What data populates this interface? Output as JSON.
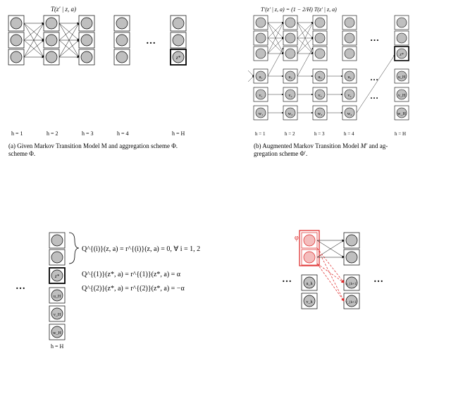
{
  "titles": {
    "a_top": "T(z′ | z, a)",
    "b_top": "T′(z′ | z, a) = (1 − 2/H) T(z′ | z, a)"
  },
  "captions": {
    "a": "(a) Given Markov Transition Model M and aggregation scheme Φ.",
    "b": "(b) Augmented Markov Transition Model M′ and aggregation scheme Φ′."
  },
  "hlabels": {
    "h1": "h = 1",
    "h2": "h = 2",
    "h3": "h = 3",
    "h4": "h = 4",
    "hH": "h = H"
  },
  "node_labels": {
    "zstar": "z*",
    "u1": "u₁",
    "u2": "u₂",
    "u3": "u₃",
    "u4": "u₄",
    "uH": "u_H",
    "v1": "v₁",
    "v2": "v₂",
    "v3": "v₃",
    "v4": "v₄",
    "vH": "v_H",
    "w1": "w₁",
    "w2": "w₂",
    "w3": "w₃",
    "w4": "w₄",
    "wH": "w_H",
    "uh": "u_h",
    "uhp1": "u_{h+1}",
    "vh": "v_h",
    "vhp1": "v_{h+1}"
  },
  "phi_label": "φ",
  "ellipsis": "…",
  "eqns": {
    "q0": "Q^{(i)}(z, a) = r^{(i)}(z, a) = 0,   ∀ i = 1, 2",
    "q1": "Q^{(1)}(z*, a) = r^{(1)}(z*, a) = α",
    "q2": "Q^{(2)}(z*, a) = r^{(2)}(z*, a) = −α"
  },
  "chart_data": {
    "type": "diagram",
    "panels": [
      {
        "id": "a",
        "caption_key": "captions.a",
        "columns": [
          1,
          2,
          3,
          4
        ],
        "nodes_per_column": 3,
        "final_column_nodes": 3,
        "final_column_special_index": 2,
        "final_column_special_label_key": "node_labels.zstar",
        "fully_connected_between_columns": [
          [
            1,
            2
          ],
          [
            2,
            3
          ]
        ],
        "ellipsis_between": [
          4,
          "H"
        ]
      },
      {
        "id": "b",
        "caption_key": "captions.b",
        "columns": [
          1,
          2,
          3,
          4
        ],
        "top_nodes_per_column": 3,
        "final_column_top_nodes": 3,
        "final_column_special_index": 2,
        "final_column_special_label_key": "node_labels.zstar",
        "chains": [
          "u",
          "v",
          "w"
        ],
        "chain_length": 4,
        "chain_final_targets_zstar": true,
        "chain_abstract_start": true,
        "ellipsis_between": [
          4,
          "H"
        ]
      },
      {
        "id": "c",
        "column_label_key": "hlabels.hH",
        "nodes": [
          "blank",
          "blank",
          "z*",
          "uH",
          "vH",
          "wH"
        ],
        "brace_rows": [
          0,
          1
        ],
        "eqn_keys": [
          "eqns.q0",
          "eqns.q1",
          "eqns.q2"
        ]
      },
      {
        "id": "d",
        "columns": 3,
        "top_nodes_per_column": 2,
        "red_aggregate_on_column": 1,
        "chains": [
          [
            "uh",
            "uhp1"
          ],
          [
            "vh",
            "vhp1"
          ]
        ],
        "ellipsis_left": true,
        "ellipsis_right": true
      }
    ]
  }
}
